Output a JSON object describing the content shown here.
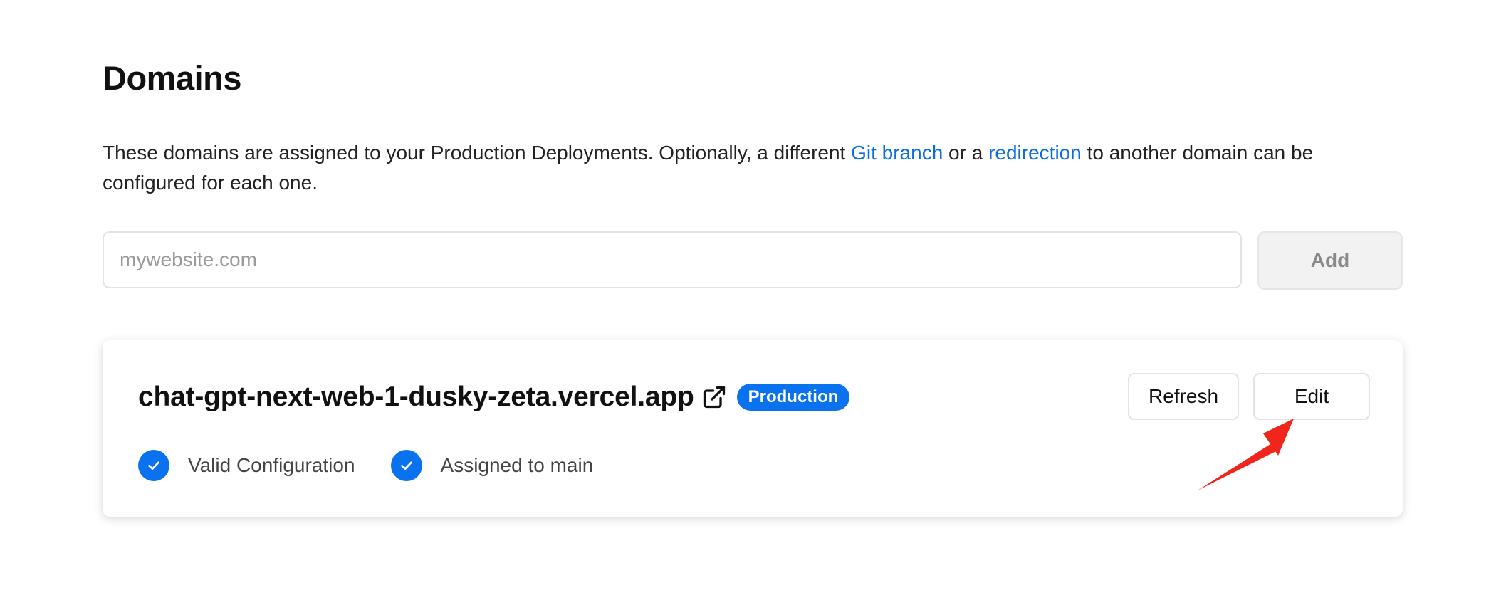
{
  "section": {
    "title": "Domains",
    "description": {
      "part1": "These domains are assigned to your Production Deployments. Optionally, a different ",
      "link1": "Git branch",
      "part2": " or a ",
      "link2": "redirection",
      "part3": " to another domain can be configured for each one."
    }
  },
  "add_form": {
    "placeholder": "mywebsite.com",
    "value": "",
    "add_label": "Add"
  },
  "domain_card": {
    "domain": "chat-gpt-next-web-1-dusky-zeta.vercel.app",
    "external_link_icon": "external-link-icon",
    "badge": "Production",
    "refresh_label": "Refresh",
    "edit_label": "Edit",
    "statuses": [
      {
        "icon": "check-icon",
        "label": "Valid Configuration"
      },
      {
        "icon": "check-icon",
        "label": "Assigned to main"
      }
    ]
  },
  "colors": {
    "accent": "#0a72ef",
    "link": "#0b6ee0",
    "annotation_arrow": "#f0261c"
  }
}
